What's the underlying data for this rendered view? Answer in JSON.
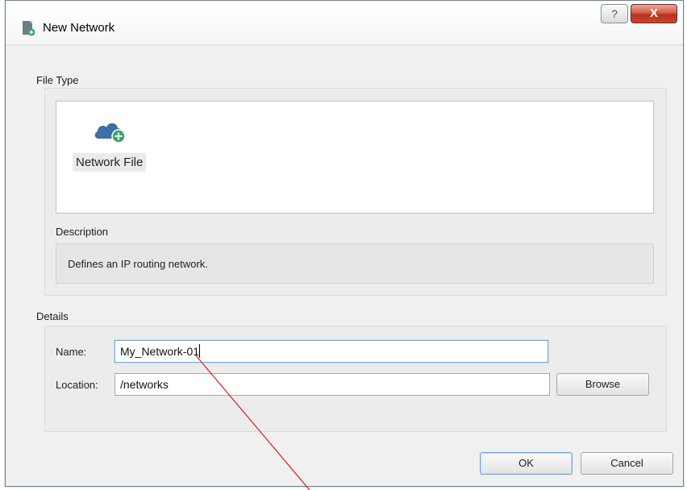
{
  "window": {
    "title": "New Network",
    "help_glyph": "?",
    "close_glyph": "X",
    "icon": "document-network-icon"
  },
  "file_type": {
    "label": "File Type",
    "items": [
      {
        "label": "Network File",
        "icon": "cloud-add-icon",
        "selected": true
      }
    ]
  },
  "description": {
    "label": "Description",
    "text": "Defines an IP routing network."
  },
  "details": {
    "label": "Details",
    "name_label": "Name:",
    "name_value": "My_Network-01",
    "location_label": "Location:",
    "location_value": "/networks",
    "browse_label": "Browse"
  },
  "buttons": {
    "ok_label": "OK",
    "cancel_label": "Cancel"
  },
  "colors": {
    "close_red": "#c9452f",
    "focus_blue": "#7fa9d8",
    "cloud_blue": "#3f6ea6",
    "add_green": "#3aa36a",
    "annotation_line": "#e01b1b"
  }
}
